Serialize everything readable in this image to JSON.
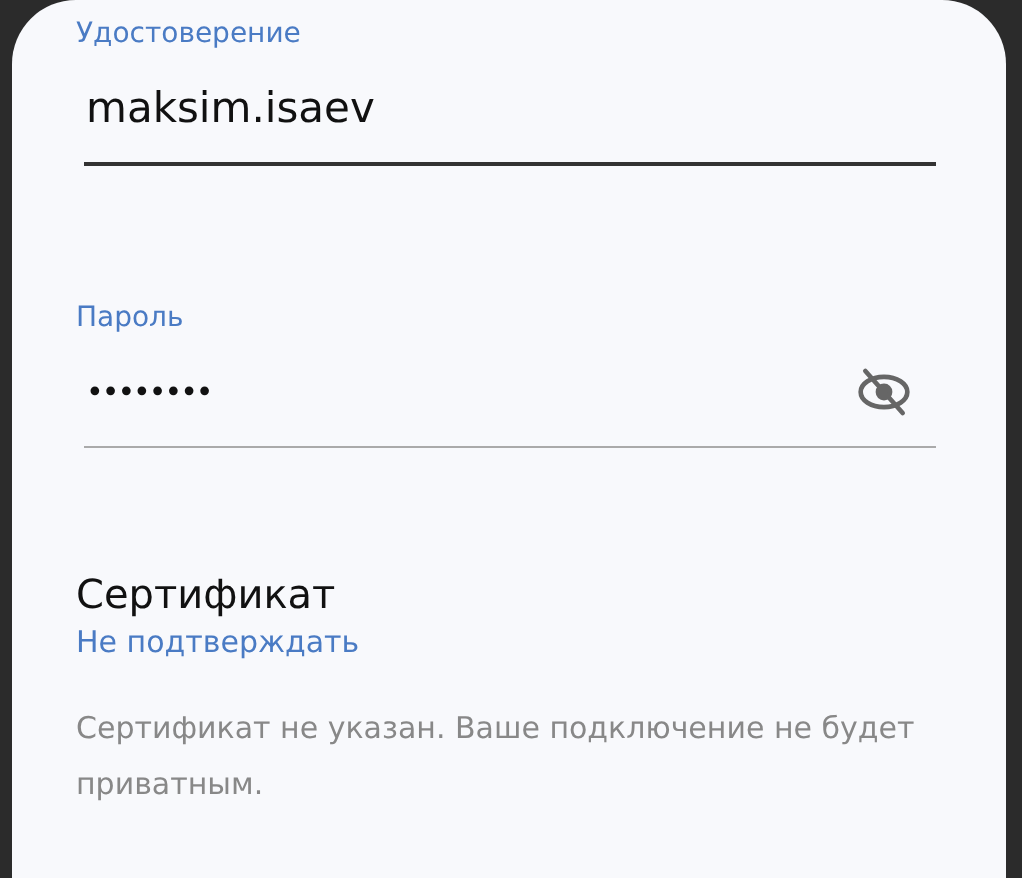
{
  "fields": [
    {
      "kind": "text",
      "label": "Удостоверение",
      "value": "maksim.isaev",
      "focused": true
    },
    {
      "kind": "password",
      "label": "Пароль",
      "value": "••••••••",
      "focused": false,
      "password_visible": false
    }
  ],
  "certificate": {
    "title": "Сертификат",
    "value": "Не подтверждать",
    "note": "Сертификат не указан. Ваше подключение не будет приватным."
  }
}
